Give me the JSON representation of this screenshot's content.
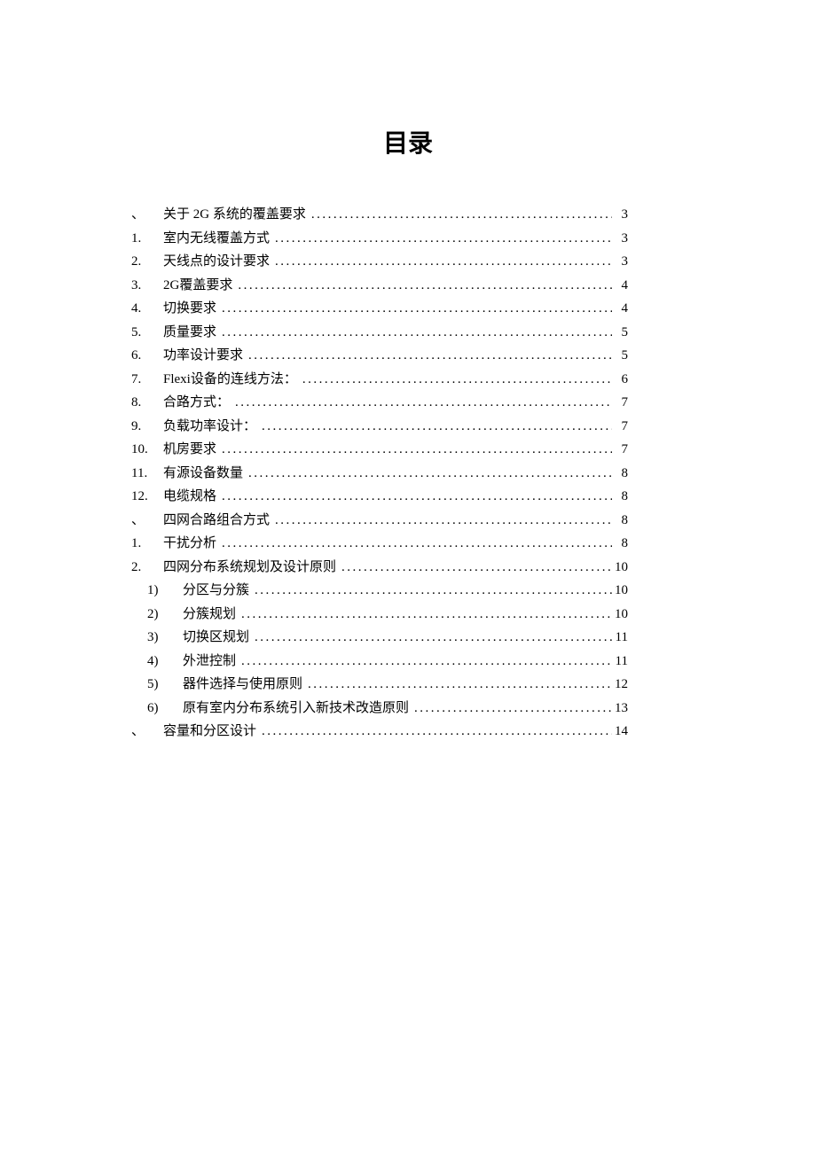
{
  "title": "目录",
  "entries": [
    {
      "marker": "、",
      "markerClass": "marker-cn",
      "label": "关于 2G 系统的覆盖要求 ",
      "page": " 3",
      "indent": false
    },
    {
      "marker": "1.",
      "markerClass": "",
      "label": "室内无线覆盖方式 ",
      "page": " 3",
      "indent": false
    },
    {
      "marker": "2.",
      "markerClass": "",
      "label": "天线点的设计要求",
      "page": " 3",
      "indent": false
    },
    {
      "marker": "3.",
      "markerClass": "",
      "label": "2G覆盖要求",
      "page": "4",
      "indent": false
    },
    {
      "marker": "4.",
      "markerClass": "",
      "label": "切换要求",
      "page": "4",
      "indent": false
    },
    {
      "marker": "5.",
      "markerClass": "",
      "label": "质量要求",
      "page": "5",
      "indent": false
    },
    {
      "marker": "6.",
      "markerClass": "",
      "label": "功率设计要求",
      "page": "5",
      "indent": false
    },
    {
      "marker": "7.",
      "markerClass": "",
      "label": "Flexi设备的连线方法： ",
      "page": "6",
      "indent": false
    },
    {
      "marker": "8.",
      "markerClass": "",
      "label": "合路方式： ",
      "page": "7",
      "indent": false
    },
    {
      "marker": "9.",
      "markerClass": "",
      "label": "负载功率设计： ",
      "page": "7",
      "indent": false
    },
    {
      "marker": "10.",
      "markerClass": "",
      "label": "机房要求",
      "page": "7",
      "indent": false
    },
    {
      "marker": "11.",
      "markerClass": "",
      "label": "有源设备数量",
      "page": "8",
      "indent": false
    },
    {
      "marker": "12.",
      "markerClass": "",
      "label": "电缆规格",
      "page": "8",
      "indent": false
    },
    {
      "marker": "、",
      "markerClass": "marker-cn",
      "label": "四网合路组合方式",
      "page": "8",
      "indent": false
    },
    {
      "marker": "1.",
      "markerClass": "",
      "label": "干扰分析",
      "page": "8",
      "indent": false
    },
    {
      "marker": "2.",
      "markerClass": "",
      "label": "四网分布系统规划及设计原则 ",
      "page": "10",
      "indent": false
    },
    {
      "marker": "1)",
      "markerClass": "",
      "label": "分区与分簇 ",
      "page": "10",
      "indent": true
    },
    {
      "marker": "2)",
      "markerClass": "",
      "label": "分簇规划 ",
      "page": "10",
      "indent": true
    },
    {
      "marker": "3)",
      "markerClass": "",
      "label": "切换区规划 ",
      "page": "11",
      "indent": true
    },
    {
      "marker": "4)",
      "markerClass": "",
      "label": "外泄控制 ",
      "page": "11",
      "indent": true
    },
    {
      "marker": "5)",
      "markerClass": "",
      "label": "器件选择与使用原则 ",
      "page": "12",
      "indent": true
    },
    {
      "marker": "6)",
      "markerClass": "",
      "label": "原有室内分布系统引入新技术改造原则",
      "page": "13",
      "indent": true
    },
    {
      "marker": "、",
      "markerClass": "marker-cn",
      "label": "容量和分区设计",
      "page": "14",
      "indent": false
    }
  ]
}
